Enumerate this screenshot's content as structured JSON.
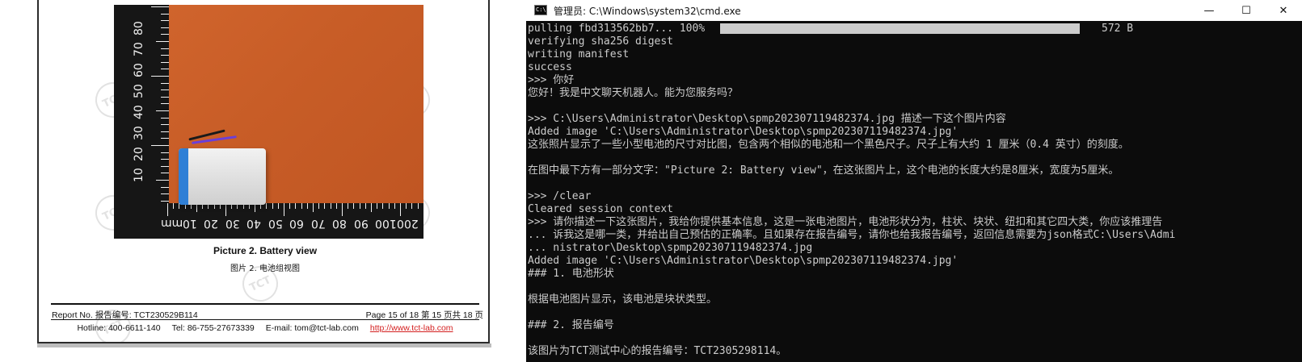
{
  "document": {
    "watermark_text": "TCT",
    "ruler_vertical_numbers": [
      "10",
      "20",
      "30",
      "40",
      "50",
      "60",
      "70",
      "80"
    ],
    "ruler_horizontal_numbers": [
      "mm",
      "10",
      "20",
      "30",
      "40",
      "50",
      "60",
      "70",
      "80",
      "90",
      "100",
      "200"
    ],
    "caption_en": "Picture 2. Battery view",
    "caption_zh": "图片 2.  电池组视图",
    "footer": {
      "report_no": "Report No.  报告编号: TCT230529B114",
      "page": "Page 15 of 18  第 15 页共 18 页",
      "hotline": "Hotline: 400-6611-140",
      "tel": "Tel: 86-755-27673339",
      "email": "E-mail: tom@tct-lab.com",
      "url": "http://www.tct-lab.com"
    }
  },
  "cmd_window": {
    "title": "管理员: C:\\Windows\\system32\\cmd.exe",
    "icon_label": "C:\\.",
    "minimize": "—",
    "maximize": "☐",
    "close": "✕",
    "progress": {
      "label": "pulling fbd313562bb7... 100%",
      "fraction": 1.0,
      "size": "572 B"
    },
    "lines": [
      "verifying sha256 digest",
      "writing manifest",
      "success",
      ">>> 你好",
      "您好！我是中文聊天机器人。能为您服务吗？",
      "",
      ">>> C:\\Users\\Administrator\\Desktop\\spmp202307119482374.jpg 描述一下这个图片内容",
      "Added image 'C:\\Users\\Administrator\\Desktop\\spmp202307119482374.jpg'",
      "这张照片显示了一些小型电池的尺寸对比图，包含两个相似的电池和一个黑色尺子。尺子上有大约 1 厘米（0.4 英寸）的刻度。",
      "",
      "在图中最下方有一部分文字：\"Picture 2: Battery view\"，在这张图片上，这个电池的长度大约是8厘米，宽度为5厘米。",
      "",
      ">>> /clear",
      "Cleared session context",
      ">>> 请你描述一下这张图片，我给你提供基本信息，这是一张电池图片，电池形状分为，柱状、块状、纽扣和其它四大类，你应该推理告",
      "... 诉我这是哪一类，并给出自己预估的正确率。且如果存在报告编号，请你也给我报告编号，返回信息需要为json格式C:\\Users\\Admi",
      "... nistrator\\Desktop\\spmp202307119482374.jpg",
      "Added image 'C:\\Users\\Administrator\\Desktop\\spmp202307119482374.jpg'",
      "### 1. 电池形状",
      "",
      "根据电池图片显示，该电池是块状类型。",
      "",
      "### 2. 报告编号",
      "",
      "该图片为TCT测试中心的报告编号：TCT2305298114。"
    ]
  }
}
